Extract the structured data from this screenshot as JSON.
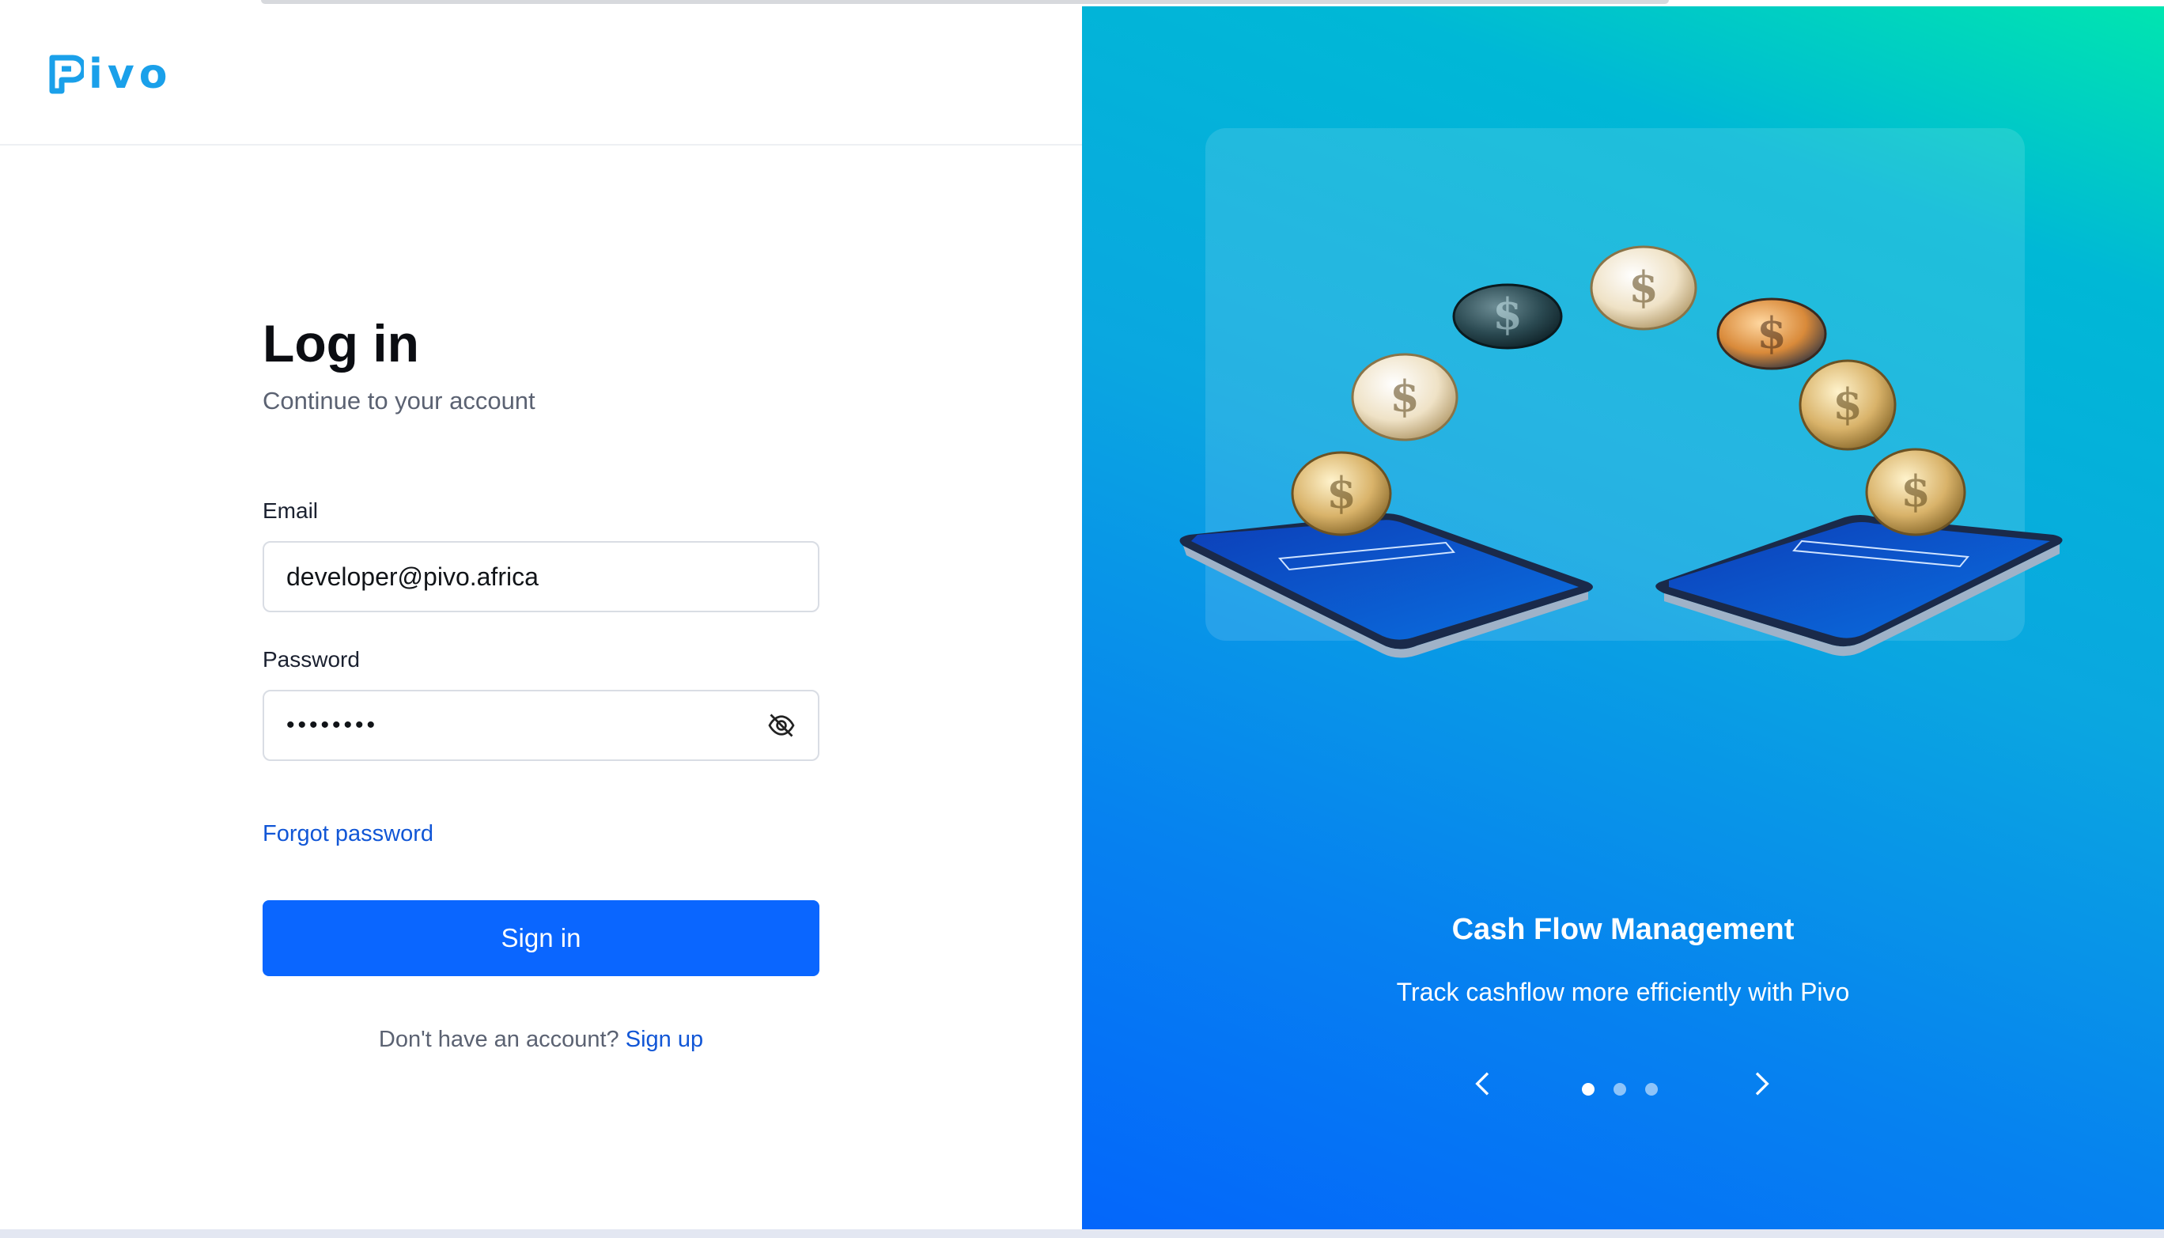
{
  "brand": {
    "name": "Pivo",
    "logo_color": "#1aa0ea"
  },
  "login": {
    "title": "Log in",
    "subtitle": "Continue to your account",
    "email_label": "Email",
    "email_value": "developer@pivo.africa",
    "password_label": "Password",
    "password_masked": "••••••••",
    "password_toggle_icon": "eye-off-icon",
    "forgot_password": "Forgot password",
    "signin_button": "Sign in",
    "signup_prompt": "Don't have an account?",
    "signup_link": "Sign up"
  },
  "carousel": {
    "slide_title": "Cash Flow Management",
    "slide_subtitle": "Track cashflow more efficiently with Pivo",
    "total_slides": 3,
    "active_slide": 1,
    "prev_icon": "chevron-left-icon",
    "next_icon": "chevron-right-icon"
  },
  "colors": {
    "primary": "#0a66ff",
    "link": "#1156d6",
    "gradient_top": "#00e5b0",
    "gradient_bottom": "#0466fb"
  }
}
